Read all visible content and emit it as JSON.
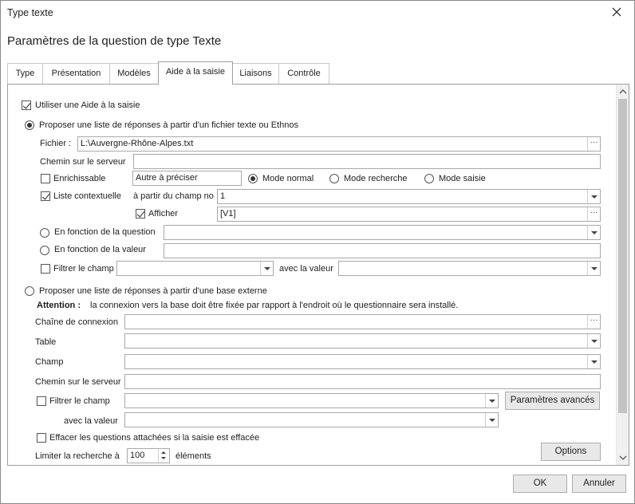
{
  "window": {
    "title": "Type texte"
  },
  "header": {
    "title": "Paramètres de la question de type Texte"
  },
  "tabs": [
    {
      "label": "Type"
    },
    {
      "label": "Présentation"
    },
    {
      "label": "Modèles"
    },
    {
      "label": "Aide à la saisie"
    },
    {
      "label": "Liaisons"
    },
    {
      "label": "Contrôle"
    }
  ],
  "active_tab": "Aide à la saisie",
  "main": {
    "use_aid": {
      "label": "Utiliser une Aide à la saisie",
      "checked": true
    },
    "file_option": {
      "label": "Proposer une liste de réponses à partir d'un fichier texte ou Ethnos",
      "selected": true,
      "fichier_label": "Fichier :",
      "fichier_value": "L:\\Auvergne-Rhône-Alpes.txt",
      "server_path_label": "Chemin sur le serveur",
      "server_path_value": "",
      "enrichissable_label": "Enrichissable",
      "enrichissable_checked": false,
      "autre_value": "Autre à préciser",
      "modes": [
        {
          "label": "Mode normal",
          "selected": true
        },
        {
          "label": "Mode recherche",
          "selected": false
        },
        {
          "label": "Mode saisie",
          "selected": false
        }
      ],
      "liste_label": "Liste contextuelle",
      "liste_checked": true,
      "a_partir_label": "à partir du  champ no",
      "champ_no_value": "1",
      "afficher_label": "Afficher",
      "afficher_checked": true,
      "afficher_value": "[V1]",
      "fn_question_label": "En fonction de la question",
      "fn_valeur_label": "En fonction de la valeur",
      "filtrer_label": "Filtrer le champ",
      "filtrer_checked": false,
      "avec_valeur_label": "avec la valeur"
    },
    "db_option": {
      "label": "Proposer une liste de réponses à partir d'une base externe",
      "selected": false,
      "attention_label": "Attention :",
      "attention_text": "la connexion vers la base doit être fixée par rapport à l'endroit où le questionnaire sera installé.",
      "connexion_label": "Chaîne de connexion",
      "table_label": "Table",
      "champ_label": "Champ",
      "server_path_label": "Chemin sur le serveur",
      "filtrer_label": "Filtrer le champ",
      "filtrer_checked": false,
      "advanced_button": "Paramètres avancés",
      "avec_valeur_label": "avec la valeur"
    },
    "effacer": {
      "label": "Effacer les questions attachées si la saisie est effacée",
      "checked": false
    },
    "limit": {
      "label": "Limiter la recherche à",
      "value": "100",
      "unit": "éléments"
    },
    "options_button": "Options"
  },
  "footer": {
    "ok": "OK",
    "cancel": "Annuler"
  }
}
